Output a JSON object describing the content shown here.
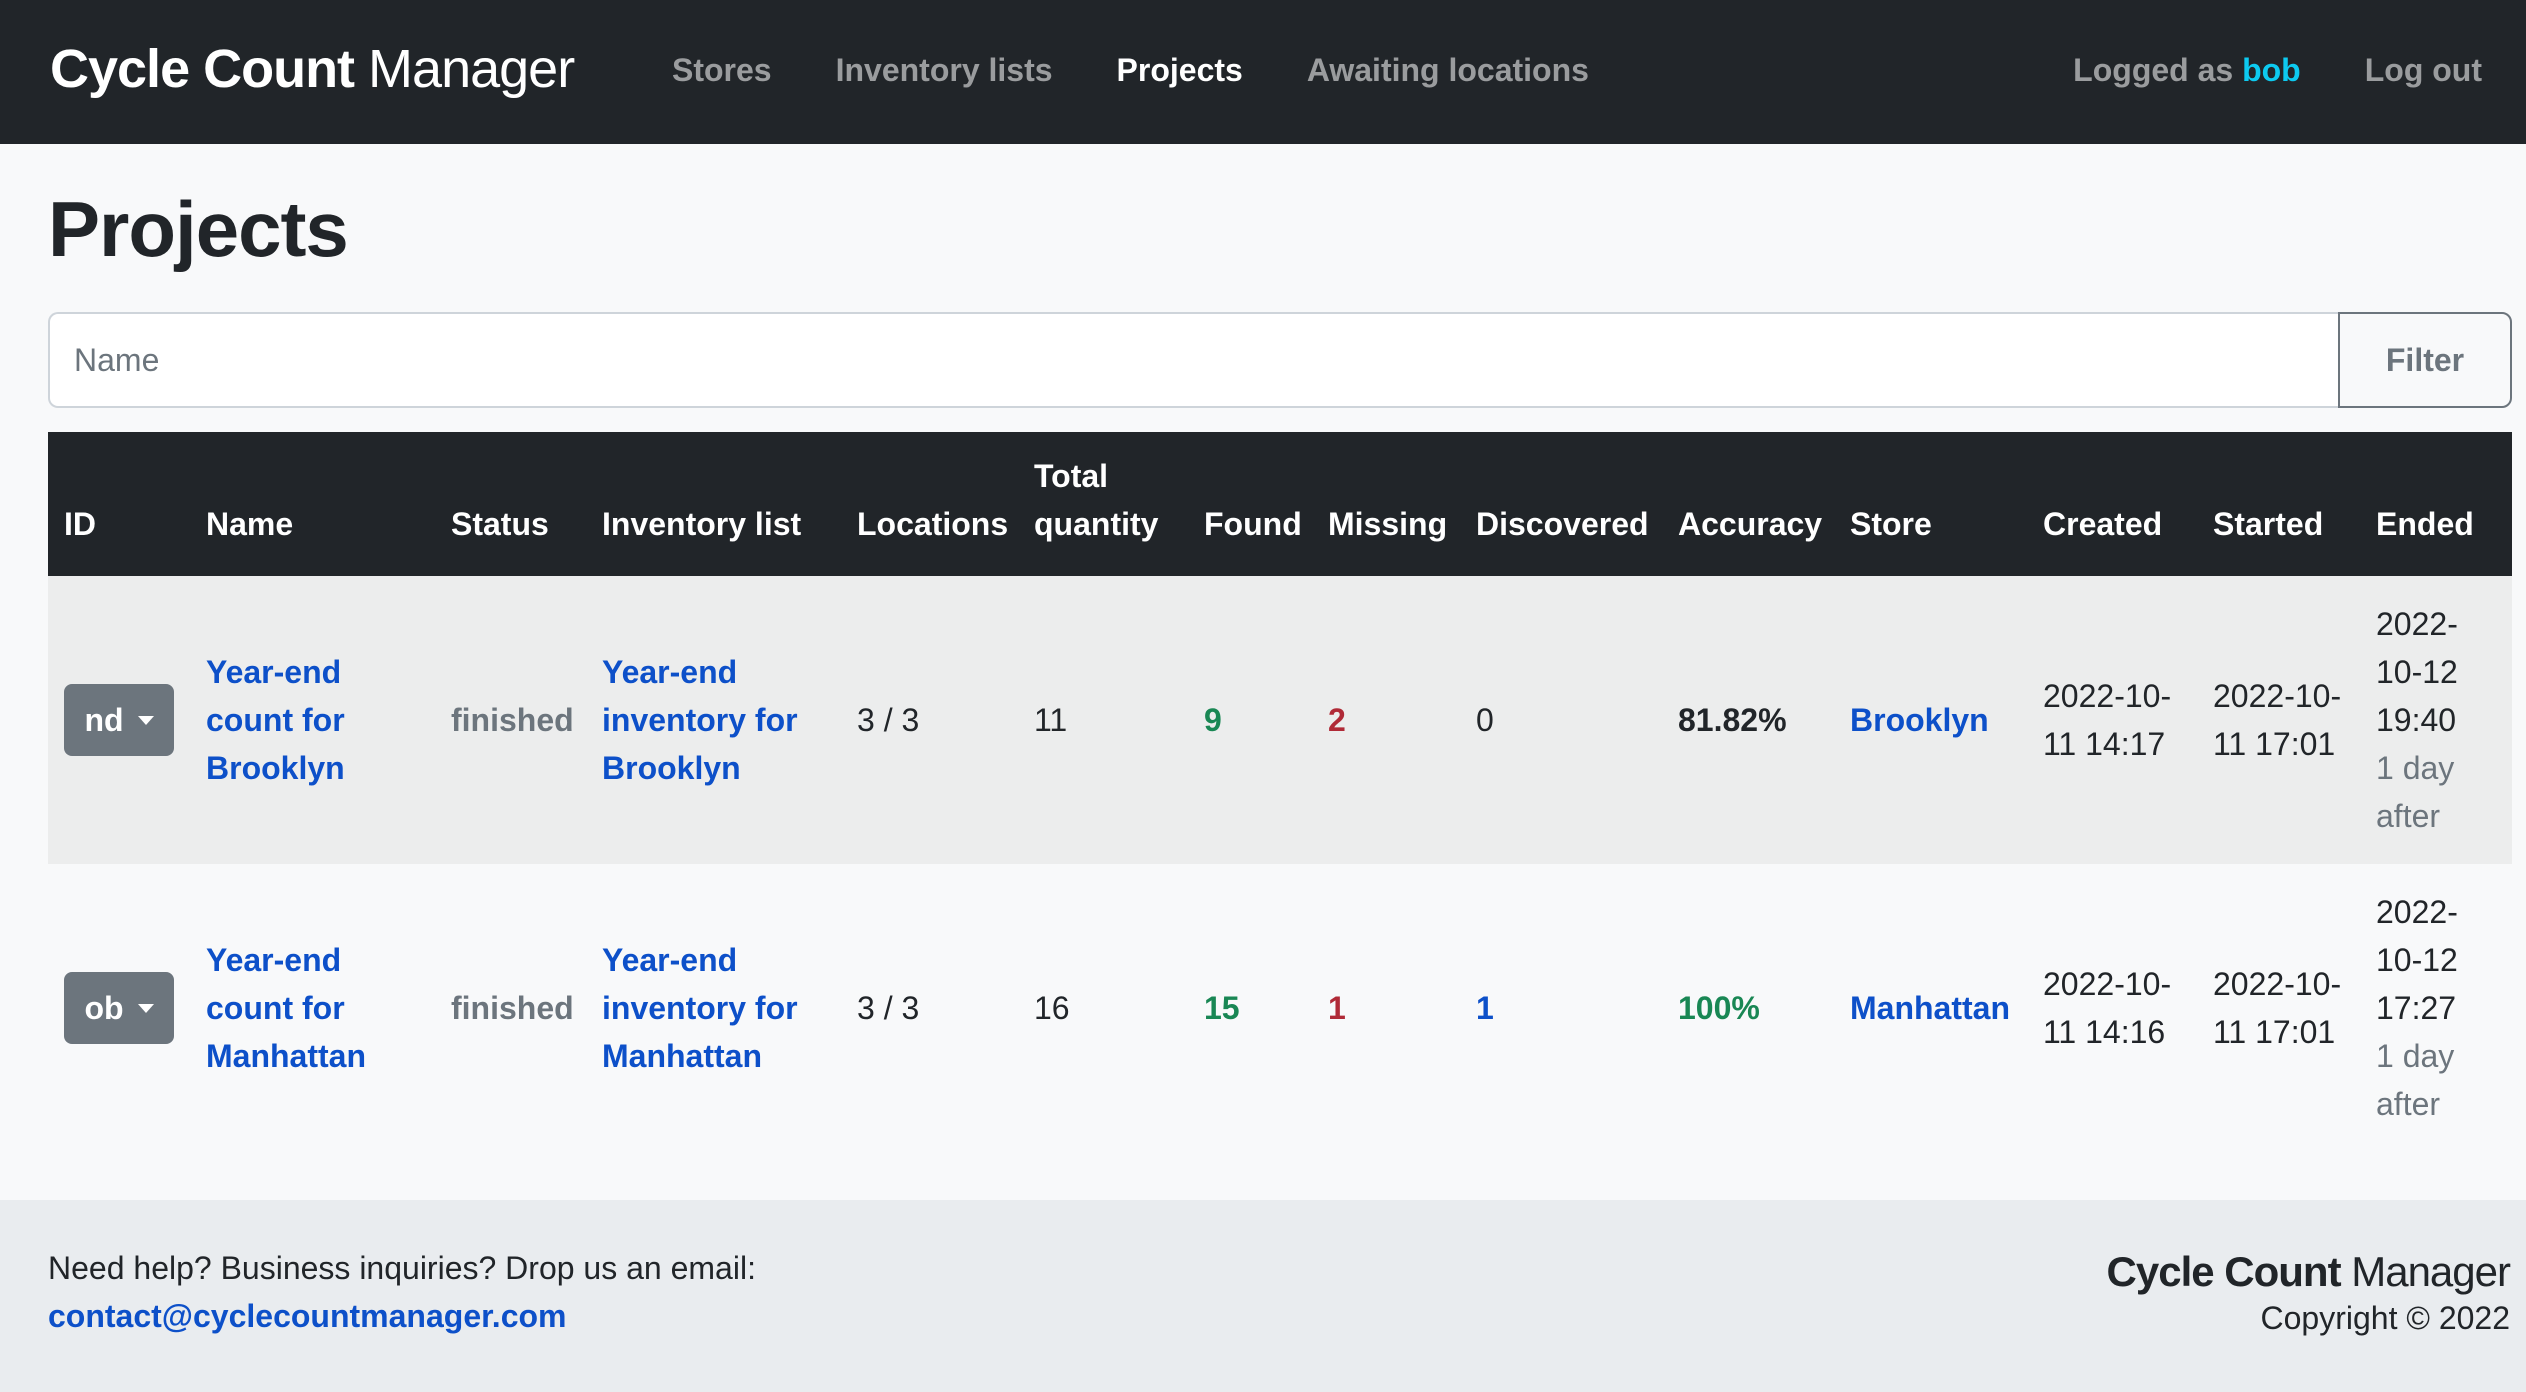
{
  "brand": {
    "bold": "Cycle Count",
    "light": " Manager"
  },
  "nav": {
    "links": [
      "Stores",
      "Inventory lists",
      "Projects",
      "Awaiting locations"
    ],
    "logged_prefix": "Logged as ",
    "user": "bob",
    "logout": "Log out"
  },
  "page_title": "Projects",
  "filter": {
    "placeholder": "Name",
    "button": "Filter"
  },
  "table": {
    "headers": [
      "ID",
      "Name",
      "Status",
      "Inventory list",
      "Locations",
      "Total quantity",
      "Found",
      "Missing",
      "Discovered",
      "Accuracy",
      "Store",
      "Created",
      "Started",
      "Ended"
    ],
    "rows": [
      {
        "id": "nd",
        "name": "Year-end count for Brooklyn",
        "status": "finished",
        "inventory_list": "Year-end inventory for Brooklyn",
        "locations": "3 / 3",
        "total_quantity": "11",
        "found": "9",
        "missing": "2",
        "discovered": "0",
        "accuracy": "81.82%",
        "store": "Brooklyn",
        "created": "2022-10-11 14:17",
        "started": "2022-10-11 17:01",
        "ended": "2022-10-12 19:40",
        "ended_rel": "1 day after"
      },
      {
        "id": "ob",
        "name": "Year-end count for Manhattan",
        "status": "finished",
        "inventory_list": "Year-end inventory for Manhattan",
        "locations": "3 / 3",
        "total_quantity": "16",
        "found": "15",
        "missing": "1",
        "discovered": "1",
        "accuracy": "100%",
        "store": "Manhattan",
        "created": "2022-10-11 14:16",
        "started": "2022-10-11 17:01",
        "ended": "2022-10-12 17:27",
        "ended_rel": "1 day after"
      }
    ]
  },
  "footer": {
    "help": "Need help? Business inquiries? Drop us an email:",
    "email": "contact@cyclecountmanager.com",
    "brand_bold": "Cycle Count",
    "brand_light": " Manager",
    "copyright": "Copyright © 2022"
  },
  "colors": {
    "navbar": "#212529",
    "link": "#0d50c9",
    "success": "#198754",
    "danger": "#b02a37",
    "user": "#0dcaf0"
  }
}
